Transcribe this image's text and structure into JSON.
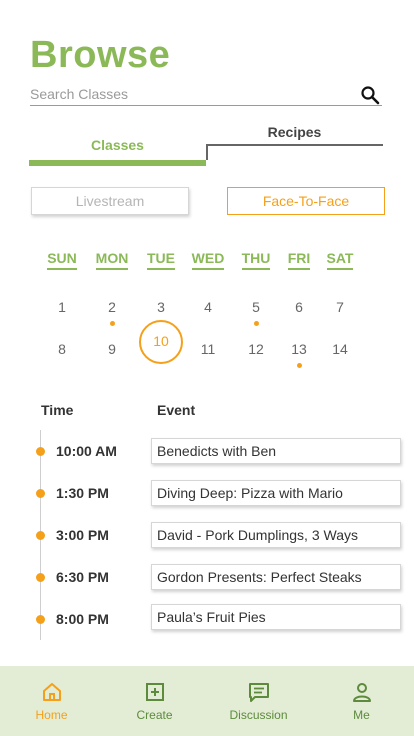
{
  "page": {
    "title": "Browse"
  },
  "search": {
    "placeholder": "Search Classes"
  },
  "tabs": [
    {
      "label": "Classes",
      "active": true
    },
    {
      "label": "Recipes",
      "active": false
    }
  ],
  "modes": [
    {
      "label": "Livestream",
      "active": false
    },
    {
      "label": "Face-To-Face",
      "active": true
    }
  ],
  "calendar": {
    "weekdays": [
      "SUN",
      "MON",
      "TUE",
      "WED",
      "THU",
      "FRI",
      "SAT"
    ],
    "weeks": [
      [
        {
          "day": "1",
          "dot": false,
          "selected": false
        },
        {
          "day": "2",
          "dot": true,
          "selected": false
        },
        {
          "day": "3",
          "dot": false,
          "selected": false
        },
        {
          "day": "4",
          "dot": false,
          "selected": false
        },
        {
          "day": "5",
          "dot": true,
          "selected": false
        },
        {
          "day": "6",
          "dot": false,
          "selected": false
        },
        {
          "day": "7",
          "dot": false,
          "selected": false
        }
      ],
      [
        {
          "day": "8",
          "dot": false,
          "selected": false
        },
        {
          "day": "9",
          "dot": false,
          "selected": false
        },
        {
          "day": "10",
          "dot": false,
          "selected": true
        },
        {
          "day": "11",
          "dot": false,
          "selected": false
        },
        {
          "day": "12",
          "dot": false,
          "selected": false
        },
        {
          "day": "13",
          "dot": true,
          "selected": false
        },
        {
          "day": "14",
          "dot": false,
          "selected": false
        }
      ]
    ]
  },
  "schedule": {
    "time_header": "Time",
    "event_header": "Event",
    "slots": [
      {
        "time": "10:00 AM",
        "event": "Benedicts with Ben"
      },
      {
        "time": "1:30 PM",
        "event": "Diving Deep: Pizza with Mario"
      },
      {
        "time": "3:00 PM",
        "event": "David - Pork Dumplings, 3 Ways"
      },
      {
        "time": "6:30 PM",
        "event": "Gordon Presents: Perfect Steaks"
      },
      {
        "time": "8:00 PM",
        "event": "Paula’s Fruit Pies"
      }
    ]
  },
  "nav": [
    {
      "label": "Home",
      "icon": "home-icon",
      "active": true
    },
    {
      "label": "Create",
      "icon": "plus-square-icon",
      "active": false
    },
    {
      "label": "Discussion",
      "icon": "chat-icon",
      "active": false
    },
    {
      "label": "Me",
      "icon": "person-icon",
      "active": false
    }
  ],
  "colors": {
    "brand_green": "#8bb958",
    "accent_orange": "#f5a01a",
    "nav_background": "#e3edd6"
  }
}
